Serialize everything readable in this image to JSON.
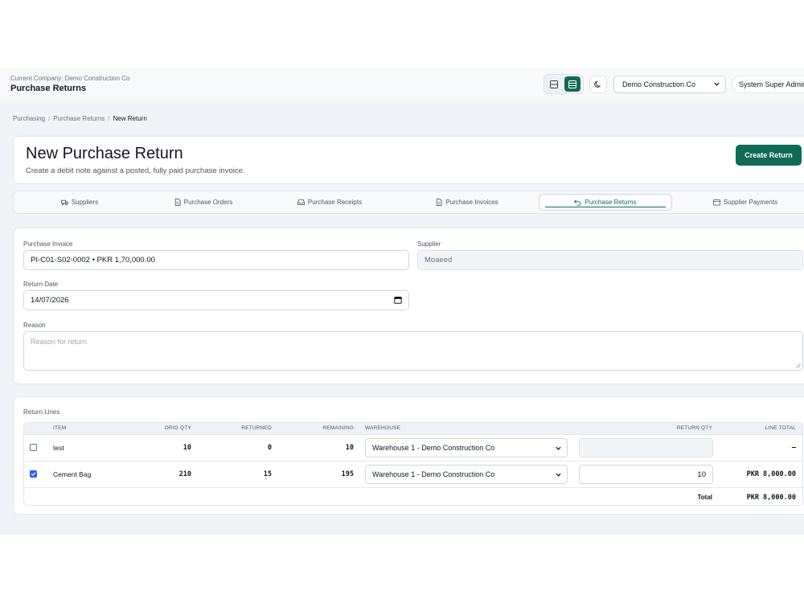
{
  "header": {
    "company_line": "Current Company: Demo Construction Co",
    "title": "Purchase Returns",
    "company_select": "Demo Construction Co",
    "user_label": "System Super Admin"
  },
  "icons": {
    "view_compact": "layout-rows-icon",
    "view_list": "layout-list-icon",
    "theme": "moon-icon"
  },
  "breadcrumb": [
    "Purchasing",
    "Purchase Returns",
    "New Return"
  ],
  "page": {
    "title": "New Purchase Return",
    "subtitle": "Create a debit note against a posted, fully paid purchase invoice.",
    "create_label": "Create Return"
  },
  "tabs": [
    {
      "label": "Suppliers",
      "icon": "truck-icon",
      "active": false
    },
    {
      "label": "Purchase Orders",
      "icon": "document-icon",
      "active": false
    },
    {
      "label": "Purchase Receipts",
      "icon": "inbox-icon",
      "active": false
    },
    {
      "label": "Purchase Invoices",
      "icon": "document-icon",
      "active": false
    },
    {
      "label": "Purchase Returns",
      "icon": "undo-icon",
      "active": true
    },
    {
      "label": "Supplier Payments",
      "icon": "wallet-icon",
      "active": false
    }
  ],
  "form": {
    "invoice_label": "Purchase Invoice",
    "invoice_value": "PI-C01-S02-0002 • PKR 1,70,000.00",
    "supplier_label": "Supplier",
    "supplier_value": "Moaeed",
    "date_label": "Return Date",
    "date_value": "14/07/2026",
    "reason_label": "Reason",
    "reason_placeholder": "Reason for return"
  },
  "lines": {
    "title": "Return Lines",
    "columns": {
      "item": "ITEM",
      "orig_qty": "ORIG QTY",
      "returned": "RETURNED",
      "remaining": "REMAINING",
      "warehouse": "WAREHOUSE",
      "return_qty": "RETURN QTY",
      "line_total": "LINE TOTAL"
    },
    "rows": [
      {
        "checked": false,
        "item": "test",
        "orig_qty": "10",
        "returned": "0",
        "remaining": "10",
        "warehouse": "Warehouse 1 - Demo Construction Co",
        "return_qty": "",
        "line_total": "—"
      },
      {
        "checked": true,
        "item": "Cement Bag",
        "orig_qty": "210",
        "returned": "15",
        "remaining": "195",
        "warehouse": "Warehouse 1 - Demo Construction Co",
        "return_qty": "10",
        "line_total": "PKR 8,000.00"
      }
    ],
    "total_label": "Total",
    "total_value": "PKR 8,000.00"
  }
}
